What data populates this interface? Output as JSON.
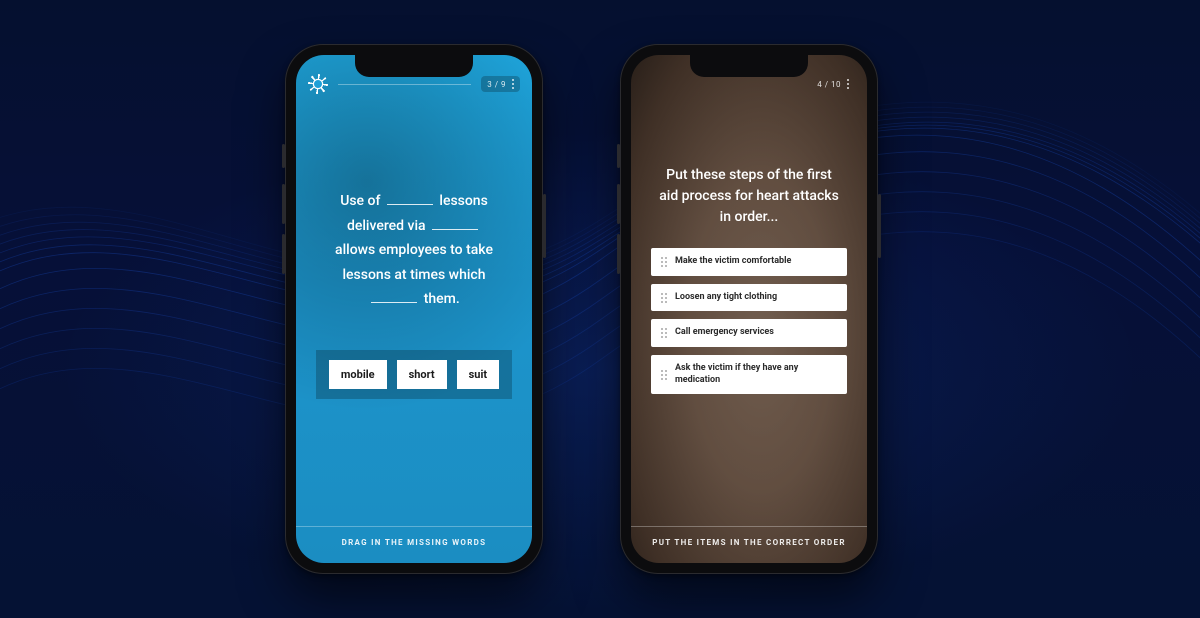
{
  "left_phone": {
    "progress_label": "3 / 9",
    "prompt": {
      "seg1": "Use of",
      "seg2": "lessons",
      "seg3": "delivered via",
      "seg4": "allows employees to take lessons at times which",
      "seg5": "them."
    },
    "words": [
      "mobile",
      "short",
      "suit"
    ],
    "footer": "DRAG IN THE MISSING WORDS"
  },
  "right_phone": {
    "progress_label": "4 / 10",
    "prompt": "Put these steps of the first aid process for heart attacks in order...",
    "items": [
      "Make the victim comfortable",
      "Loosen any tight clothing",
      "Call emergency services",
      "Ask the victim if they have any medication"
    ],
    "footer": "PUT THE ITEMS IN THE CORRECT ORDER"
  }
}
